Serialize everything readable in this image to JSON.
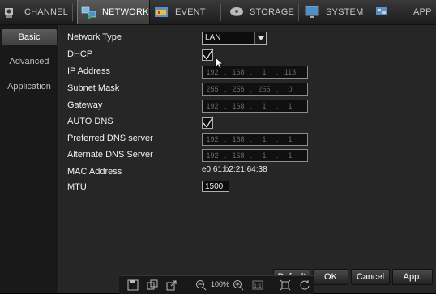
{
  "tabs": [
    {
      "label": "CHANNEL",
      "icon": "camera-icon",
      "active": false
    },
    {
      "label": "NETWORK",
      "icon": "network-icon",
      "active": true
    },
    {
      "label": "EVENT",
      "icon": "event-icon",
      "active": false
    },
    {
      "label": "STORAGE",
      "icon": "storage-icon",
      "active": false
    },
    {
      "label": "SYSTEM",
      "icon": "system-icon",
      "active": false
    },
    {
      "label": "APP",
      "icon": "app-icon",
      "active": false
    }
  ],
  "sidebar": {
    "items": [
      {
        "label": "Basic",
        "active": true
      },
      {
        "label": "Advanced",
        "active": false
      },
      {
        "label": "Application",
        "active": false
      }
    ]
  },
  "form": {
    "network_type": {
      "label": "Network Type",
      "value": "LAN"
    },
    "dhcp": {
      "label": "DHCP",
      "checked": true
    },
    "ip_address": {
      "label": "IP Address",
      "octets": [
        "192",
        "168",
        "1",
        "113"
      ]
    },
    "subnet_mask": {
      "label": "Subnet Mask",
      "octets": [
        "255",
        "255",
        "255",
        "0"
      ]
    },
    "gateway": {
      "label": "Gateway",
      "octets": [
        "192",
        "168",
        "1",
        "1"
      ]
    },
    "auto_dns": {
      "label": "AUTO DNS",
      "checked": true
    },
    "preferred_dns": {
      "label": "Preferred DNS server",
      "octets": [
        "192",
        "168",
        "1",
        "1"
      ]
    },
    "alternate_dns": {
      "label": "Alternate DNS Server",
      "octets": [
        "192",
        "168",
        "1",
        "1"
      ]
    },
    "mac_address": {
      "label": "MAC Address",
      "value": "e0:61:b2:21:64:38"
    },
    "mtu": {
      "label": "MTU",
      "value": "1500"
    }
  },
  "buttons": {
    "default": "Default",
    "ok": "OK",
    "cancel": "Cancel",
    "apply": "App."
  },
  "toolbar": {
    "zoom": "100%"
  },
  "colors": {
    "background": "#262626",
    "topbar": "#2a2a2a",
    "active_tab": "#4a4a4a",
    "text": "#f0f0f0",
    "disabled_text": "#6a6a6a"
  }
}
